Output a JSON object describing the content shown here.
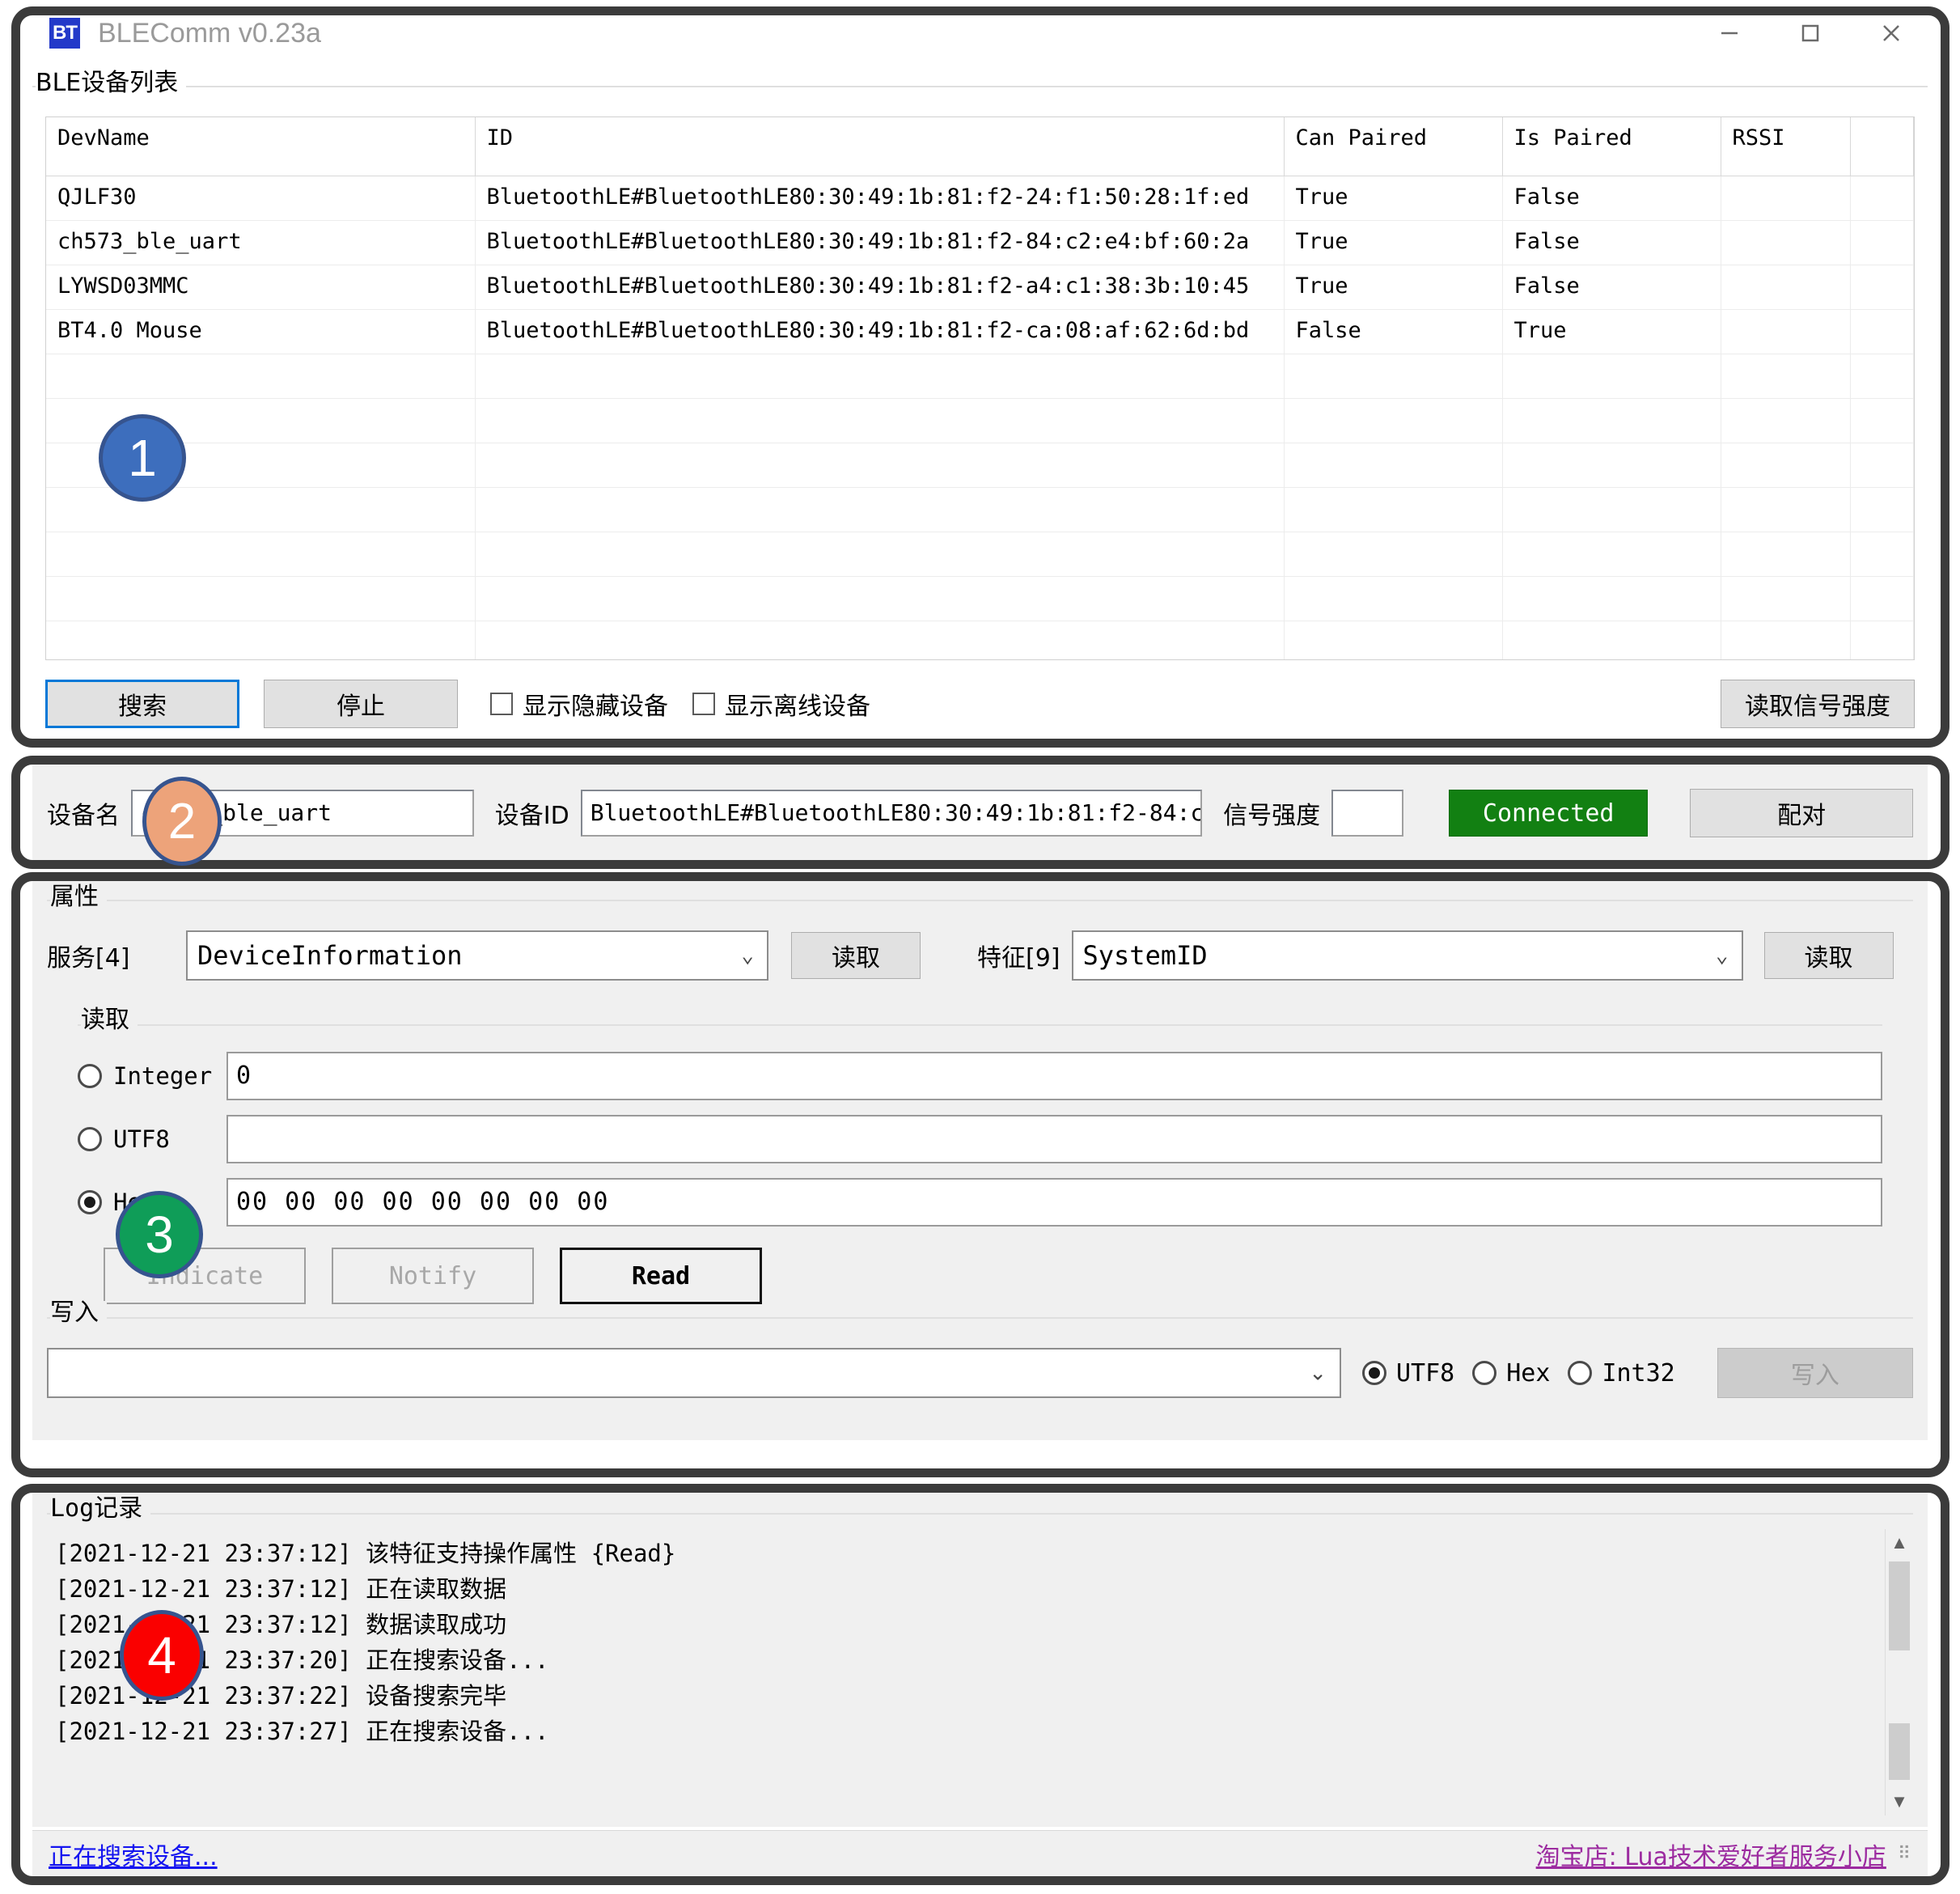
{
  "window": {
    "title": "BLEComm v0.23a",
    "icon_text": "BT",
    "minimize": "−",
    "maximize": "□",
    "close": "✕"
  },
  "device_list": {
    "group_label": "BLE设备列表",
    "columns": [
      "DevName",
      "ID",
      "Can Paired",
      "Is Paired",
      "RSSI",
      ""
    ],
    "rows": [
      {
        "dev_name": "QJLF30",
        "id": "BluetoothLE#BluetoothLE80:30:49:1b:81:f2-24:f1:50:28:1f:ed",
        "can_paired": "True",
        "is_paired": "False",
        "rssi": ""
      },
      {
        "dev_name": "ch573_ble_uart",
        "id": "BluetoothLE#BluetoothLE80:30:49:1b:81:f2-84:c2:e4:bf:60:2a",
        "can_paired": "True",
        "is_paired": "False",
        "rssi": ""
      },
      {
        "dev_name": "LYWSD03MMC",
        "id": "BluetoothLE#BluetoothLE80:30:49:1b:81:f2-a4:c1:38:3b:10:45",
        "can_paired": "True",
        "is_paired": "False",
        "rssi": ""
      },
      {
        "dev_name": "BT4.0 Mouse",
        "id": "BluetoothLE#BluetoothLE80:30:49:1b:81:f2-ca:08:af:62:6d:bd",
        "can_paired": "False",
        "is_paired": "True",
        "rssi": ""
      }
    ],
    "search_button": "搜索",
    "stop_button": "停止",
    "show_hidden_label": "显示隐藏设备",
    "show_offline_label": "显示离线设备",
    "read_rssi_button": "读取信号强度"
  },
  "device_bar": {
    "name_label": "设备名",
    "name_value": "ch573_ble_uart",
    "id_label": "设备ID",
    "id_value": "BluetoothLE#BluetoothLE80:30:49:1b:81:f2-84:c",
    "rssi_label": "信号强度",
    "rssi_value": "",
    "status": "Connected",
    "pair_button": "配对"
  },
  "properties": {
    "group_label": "属性",
    "service_label": "服务[4]",
    "service_value": "DeviceInformation",
    "service_read_button": "读取",
    "characteristic_label": "特征[9]",
    "characteristic_value": "SystemID",
    "characteristic_read_button": "读取",
    "read_group_label": "读取",
    "read_modes": [
      {
        "label": "Integer",
        "selected": false,
        "value": "0"
      },
      {
        "label": "UTF8",
        "selected": false,
        "value": ""
      },
      {
        "label": "Hex",
        "selected": true,
        "value": "00 00 00 00 00 00 00 00"
      }
    ],
    "indicate_button": "Indicate",
    "notify_button": "Notify",
    "read_button": "Read",
    "write_group_label": "写入",
    "write_value": "",
    "write_modes": [
      {
        "label": "UTF8",
        "selected": true
      },
      {
        "label": "Hex",
        "selected": false
      },
      {
        "label": "Int32",
        "selected": false
      }
    ],
    "write_button": "写入"
  },
  "log": {
    "group_label": "Log记录",
    "lines": [
      "[2021-12-21 23:37:12] 该特征支持操作属性 {Read}",
      "[2021-12-21 23:37:12] 正在读取数据",
      "[2021-12-21 23:37:12] 数据读取成功",
      "[2021-12-21 23:37:20] 正在搜索设备...",
      "[2021-12-21 23:37:22] 设备搜索完毕",
      "[2021-12-21 23:37:27] 正在搜索设备..."
    ],
    "scroll_up": "▲",
    "scroll_down": "▼"
  },
  "status_bar": {
    "left_text": "正在搜索设备...",
    "right_text": "淘宝店: Lua技术爱好者服务小店",
    "grip": "⠿"
  },
  "annotations": [
    {
      "number": "1",
      "color": "#3d6ebd"
    },
    {
      "number": "2",
      "color": "#eda37a"
    },
    {
      "number": "3",
      "color": "#0f9d58"
    },
    {
      "number": "4",
      "color": "#fa0000"
    }
  ],
  "colors": {
    "accent": "#0078d7",
    "connected": "#128012",
    "link_left": "#1414f0",
    "link_right": "#9c2ba0",
    "annotation_border": "#3b3b3b"
  }
}
